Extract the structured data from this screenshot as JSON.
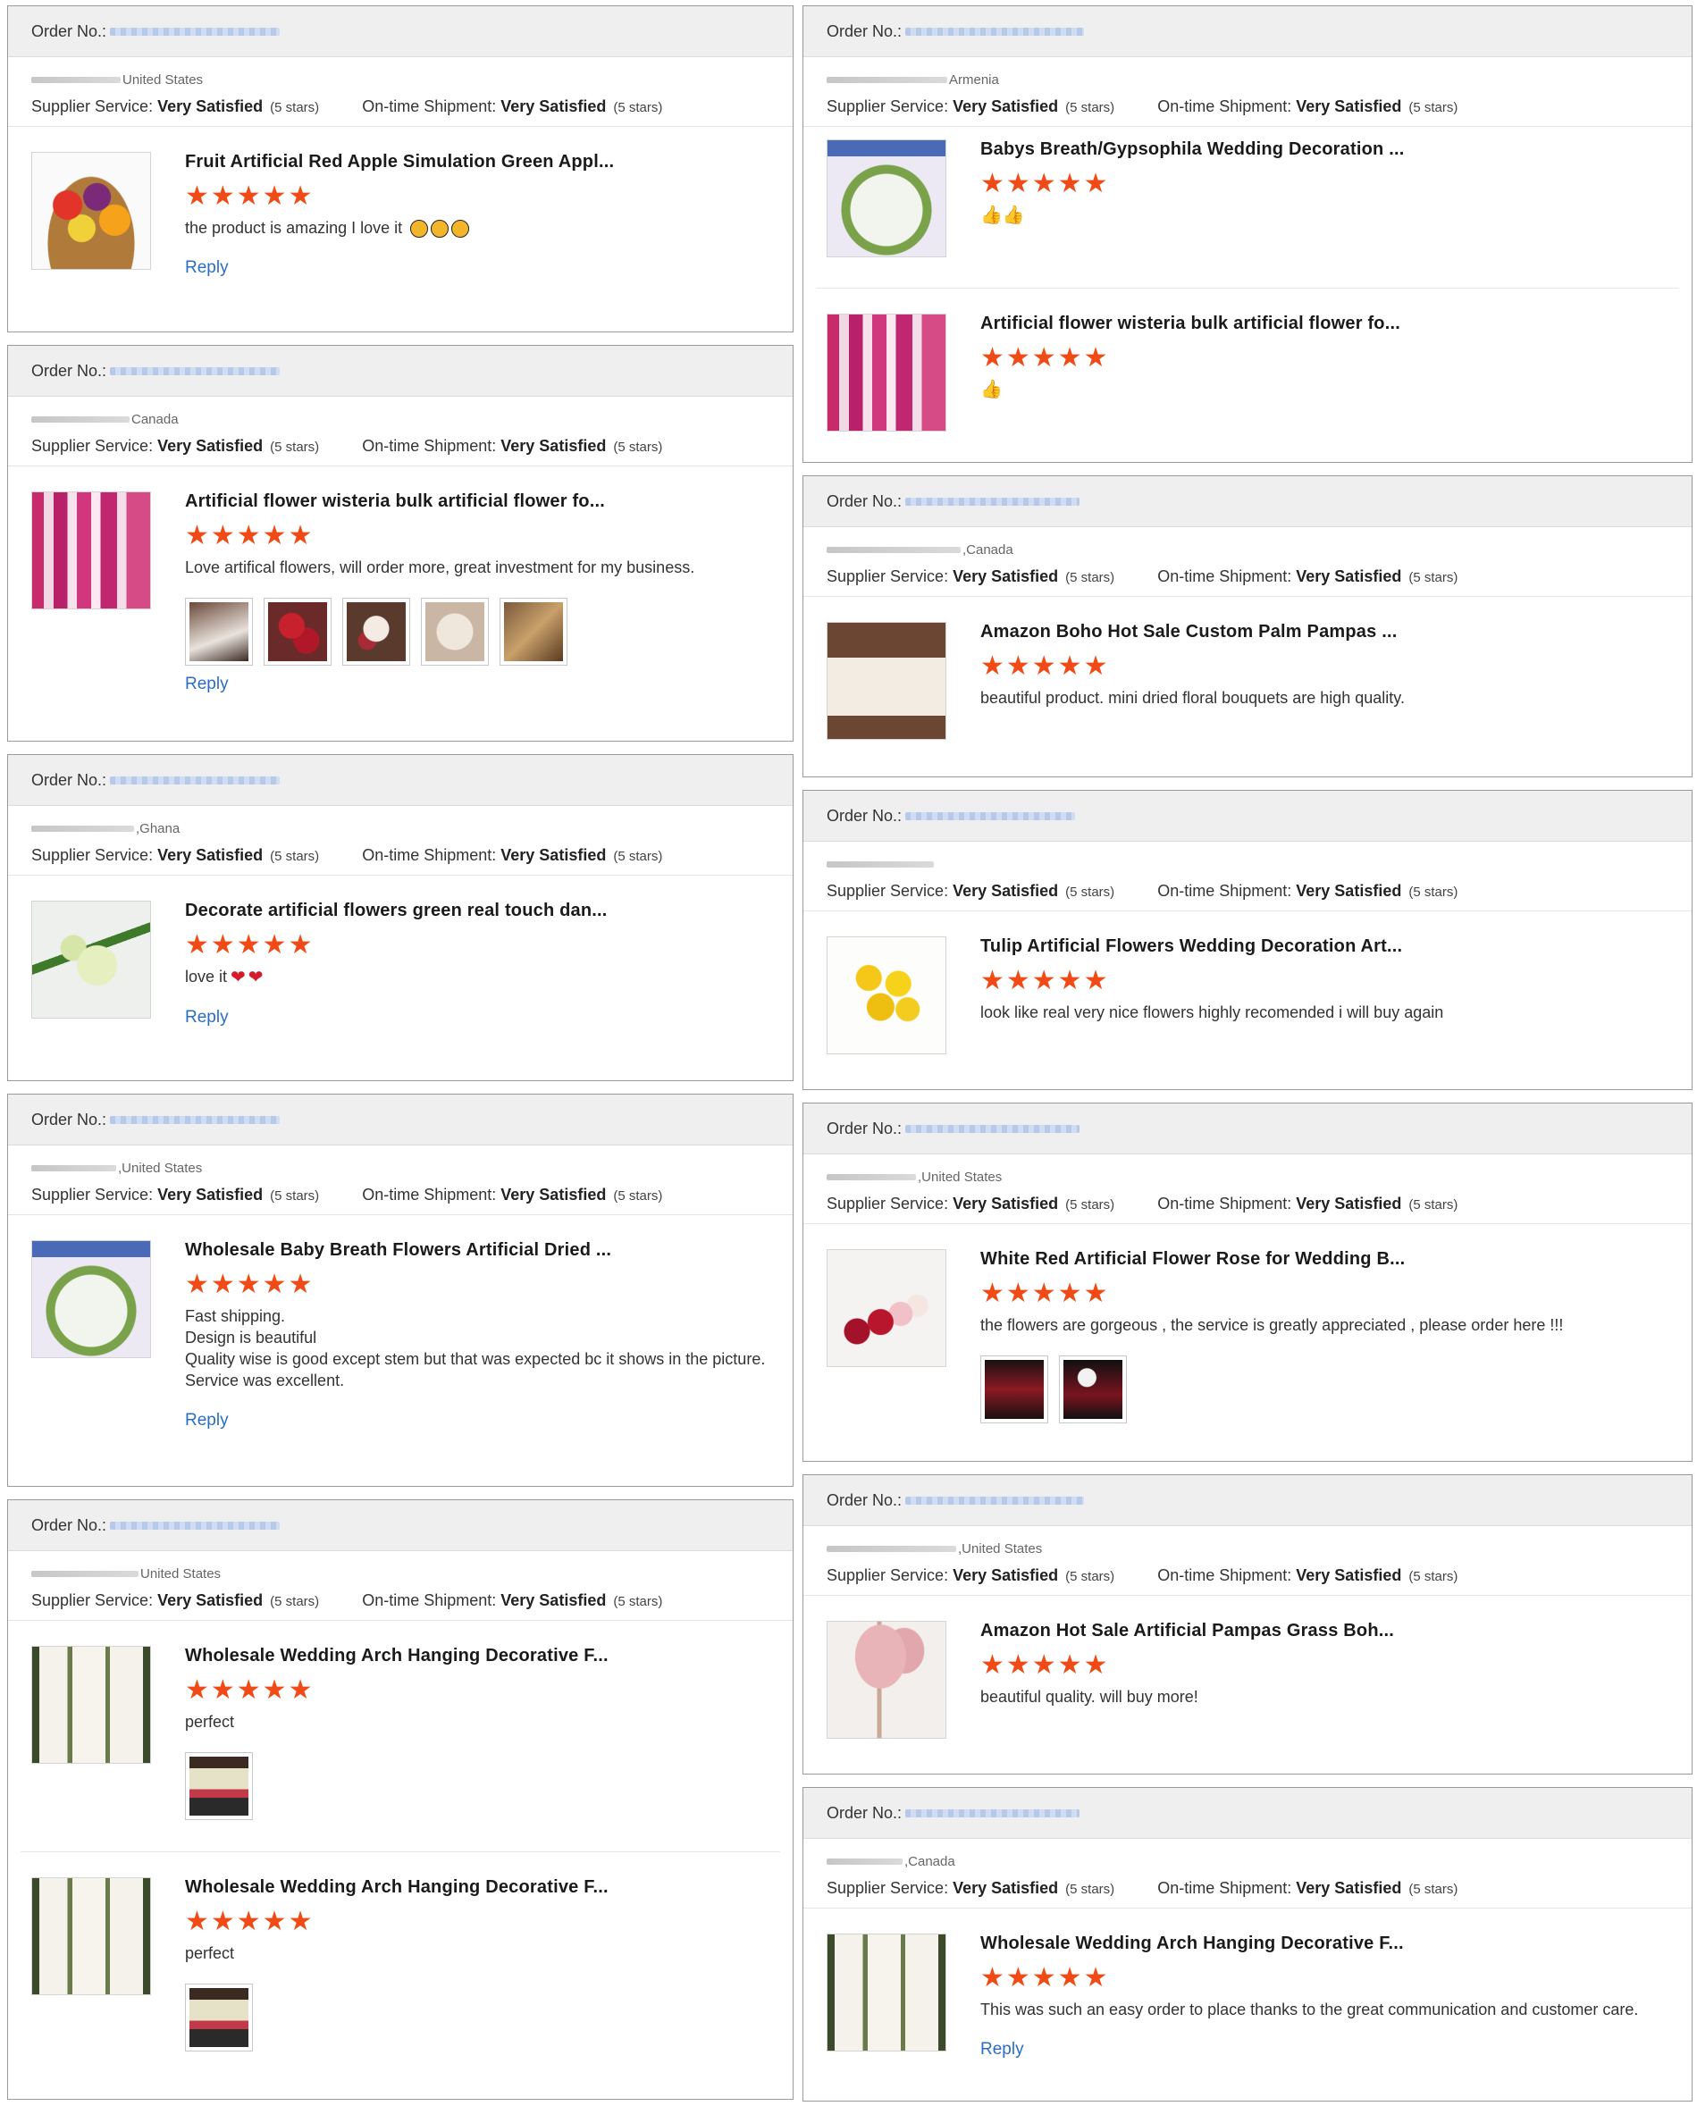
{
  "labels": {
    "order_no": "Order No.:",
    "supplier_service": "Supplier Service:",
    "ontime_shipment": "On-time Shipment:",
    "very_satisfied": "Very Satisfied",
    "five_stars": "(5 stars)",
    "reply": "Reply",
    "stars_glyph": "★★★★★"
  },
  "colors": {
    "star": "#f04a16",
    "link": "#2a6ec4",
    "header_bg": "#efefef"
  },
  "cards": [
    {
      "country": "United States",
      "items": [
        {
          "title": "Fruit Artificial Red Apple Simulation Green Appl...",
          "review": "the product is amazing I love it",
          "emoji": "star-struck-face-icon x3",
          "thumb": "fruit-basket"
        }
      ],
      "has_reply": true
    },
    {
      "country": "Canada",
      "items": [
        {
          "title": "Artificial flower wisteria bulk artificial flower fo...",
          "review": "Love artifical flowers, will order more, great investment for my business.",
          "thumb": "wisteria",
          "photos": 5
        }
      ],
      "has_reply": true
    },
    {
      "country": ",Ghana",
      "items": [
        {
          "title": "Decorate artificial flowers green real touch dan...",
          "review": "love it",
          "emoji": "heart-icon x2",
          "thumb": "green-flowers"
        }
      ],
      "has_reply": true
    },
    {
      "country": ",United States",
      "items": [
        {
          "title": "Wholesale Baby Breath Flowers Artificial Dried ...",
          "review_lines": [
            "Fast shipping.",
            "Design is beautiful",
            "Quality wise is good except stem but that was expected bc it shows in the picture.",
            "Service was excellent."
          ],
          "thumb": "babys-breath"
        }
      ],
      "has_reply": true
    },
    {
      "country": "United States",
      "items": [
        {
          "title": "Wholesale Wedding Arch Hanging Decorative F...",
          "review": "perfect",
          "thumb": "wedding-arch",
          "photos": 1
        },
        {
          "title": "Wholesale Wedding Arch Hanging Decorative F...",
          "review": "perfect",
          "thumb": "wedding-arch",
          "photos": 1
        }
      ],
      "has_reply": false
    },
    {
      "country": "Armenia",
      "items": [
        {
          "title": "Babys Breath/Gypsophila Wedding Decoration ...",
          "emoji": "thumbs-up-icon x2",
          "thumb": "babys-breath"
        },
        {
          "title": "Artificial flower wisteria bulk artificial flower fo...",
          "emoji": "thumbs-up-icon x1",
          "thumb": "wisteria"
        }
      ],
      "has_reply": false
    },
    {
      "country": ",Canada",
      "items": [
        {
          "title": "Amazon Boho Hot Sale Custom Palm Pampas ...",
          "review": "beautiful product. mini dried floral bouquets are high quality.",
          "thumb": "pampas-bouquets"
        }
      ],
      "has_reply": false
    },
    {
      "country": "",
      "items": [
        {
          "title": "Tulip Artificial Flowers Wedding Decoration Art...",
          "review": "look like real very nice flowers highly recomended i will buy again",
          "thumb": "yellow-tulips"
        }
      ],
      "has_reply": false
    },
    {
      "country": ",United States",
      "items": [
        {
          "title": "White Red Artificial Flower Rose for Wedding B...",
          "review": "the flowers are gorgeous , the service is greatly appreciated , please order here !!!",
          "thumb": "roses",
          "photos": 2
        }
      ],
      "has_reply": false
    },
    {
      "country": ",United States",
      "items": [
        {
          "title": "Amazon Hot Sale Artificial Pampas Grass Boh...",
          "review": "beautiful quality.  will buy more!",
          "thumb": "pink-pampas"
        }
      ],
      "has_reply": false
    },
    {
      "country": ",Canada",
      "items": [
        {
          "title": "Wholesale Wedding Arch Hanging Decorative F...",
          "review": "This was such an easy order to place thanks to the great communication and customer care.",
          "thumb": "wedding-arch"
        }
      ],
      "has_reply": true
    }
  ]
}
